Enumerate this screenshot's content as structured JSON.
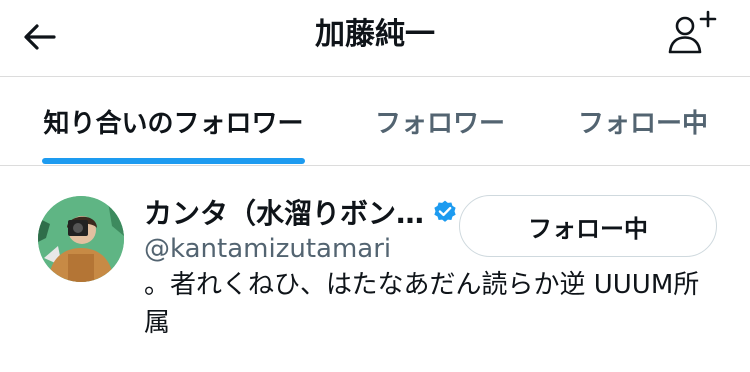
{
  "header": {
    "title": "加藤純一",
    "back_icon": "arrow-left-icon",
    "add_user_icon": "user-plus-icon"
  },
  "tabs": [
    {
      "label": "知り合いのフォロワー",
      "active": true
    },
    {
      "label": "フォロワー",
      "active": false
    },
    {
      "label": "フォロー中",
      "active": false
    }
  ],
  "user": {
    "display_name": "カンタ（水溜りボン…",
    "verified": true,
    "handle": "@kantamizutamari",
    "bio": "。者れくねひ、はたなあだん読らか逆 UUUM所属",
    "follow_button_label": "フォロー中"
  },
  "colors": {
    "accent": "#1d9bf0",
    "secondary_text": "#536471",
    "primary_text": "#0f1419"
  }
}
